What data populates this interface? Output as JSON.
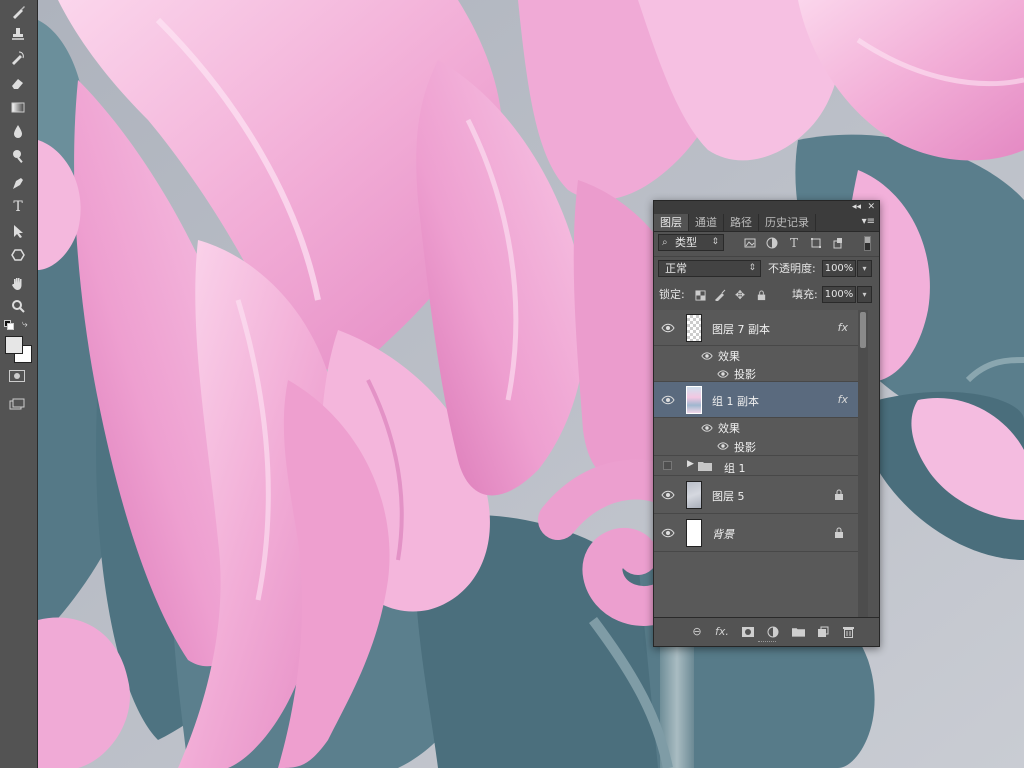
{
  "toolbar": {
    "tools": [
      {
        "name": "brush-tool",
        "icon": "brush-icon"
      },
      {
        "name": "clone-stamp-tool",
        "icon": "stamp-icon"
      },
      {
        "name": "history-brush-tool",
        "icon": "history-brush-icon"
      },
      {
        "name": "eraser-tool",
        "icon": "eraser-icon"
      },
      {
        "name": "gradient-tool",
        "icon": "gradient-icon"
      },
      {
        "name": "blur-tool",
        "icon": "drop-icon"
      },
      {
        "name": "dodge-tool",
        "icon": "dodge-icon"
      },
      {
        "name": "pen-tool",
        "icon": "pen-icon"
      },
      {
        "name": "type-tool",
        "icon": "type-icon",
        "glyph": "T"
      },
      {
        "name": "path-selection-tool",
        "icon": "arrow-icon"
      },
      {
        "name": "shape-tool",
        "icon": "hexagon-icon"
      },
      {
        "name": "hand-tool",
        "icon": "hand-icon"
      },
      {
        "name": "zoom-tool",
        "icon": "zoom-icon"
      }
    ]
  },
  "layers_panel": {
    "tabs": [
      {
        "label": "图层",
        "active": true
      },
      {
        "label": "通道",
        "active": false
      },
      {
        "label": "路径",
        "active": false
      },
      {
        "label": "历史记录",
        "active": false
      }
    ],
    "filter_kind": "类型",
    "blend_mode": "正常",
    "opacity_label": "不透明度:",
    "opacity_value": "100%",
    "lock_label": "锁定:",
    "fill_label": "填充:",
    "fill_value": "100%",
    "layers": [
      {
        "name": "图层 7 副本",
        "visible": true,
        "fx": "fx",
        "selected": false,
        "effects": [
          "效果",
          "投影"
        ]
      },
      {
        "name": "组 1 副本",
        "visible": true,
        "fx": "fx",
        "selected": true,
        "effects": [
          "效果",
          "投影"
        ]
      },
      {
        "name": "组 1",
        "visible": false,
        "type": "group"
      },
      {
        "name": "图层 5",
        "visible": true,
        "locked": true
      },
      {
        "name": "背景",
        "visible": true,
        "locked": true
      }
    ],
    "bottom_icons": [
      "link-icon",
      "fx-icon",
      "mask-icon",
      "adjustment-icon",
      "folder-icon",
      "new-layer-icon",
      "trash-icon"
    ],
    "fx_glyph": "fx."
  },
  "colors": {
    "petal_pink": "#f0a6d2",
    "petal_light": "#f9cfe8",
    "leaf_teal": "#5a7f8d",
    "leaf_dark": "#456876",
    "bg_gray": "#b8bbc4",
    "selected_layer": "#5a6a7e"
  }
}
